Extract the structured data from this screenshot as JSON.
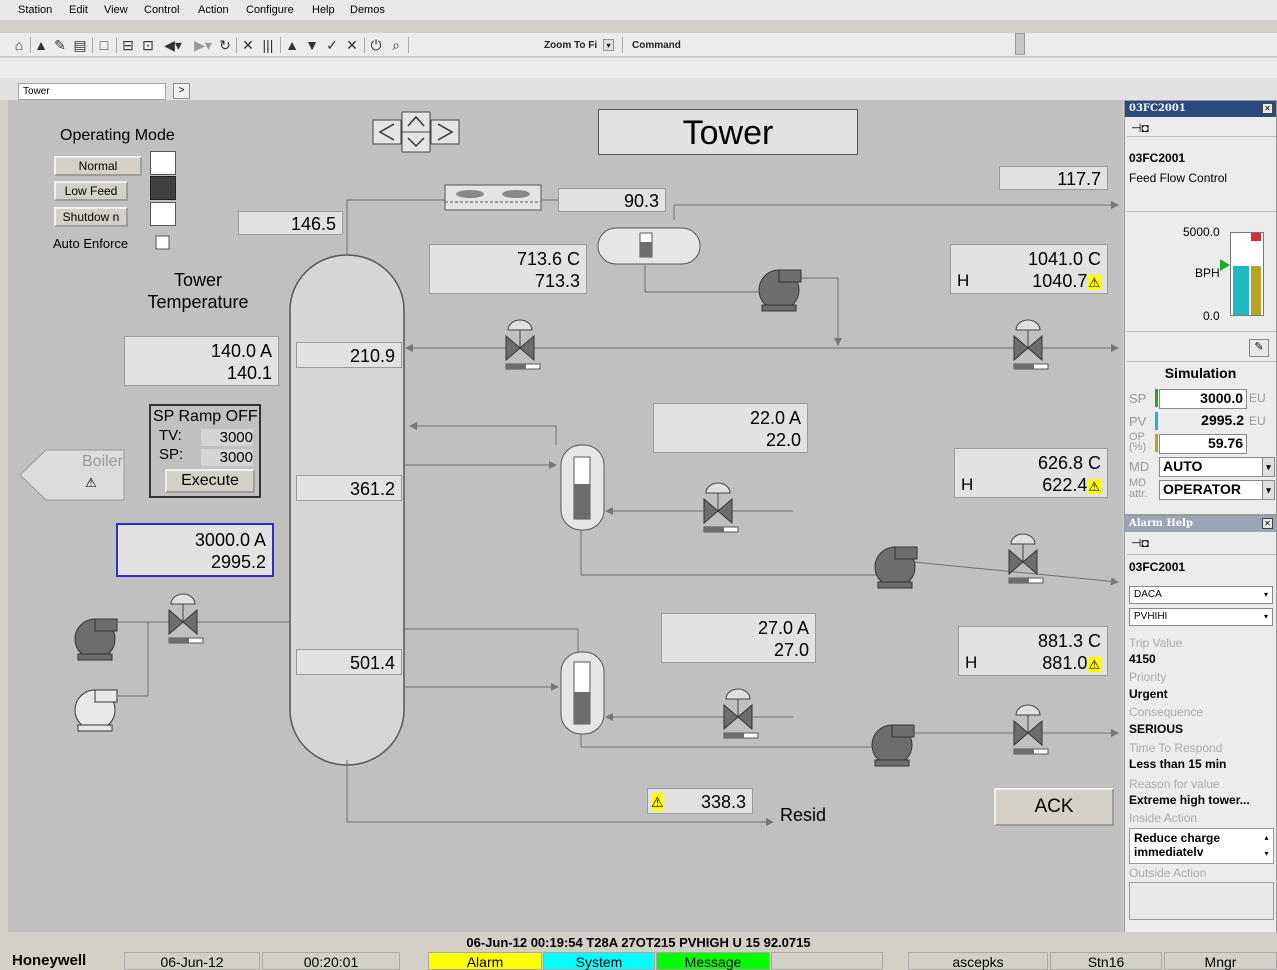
{
  "menu": [
    "Station",
    "Edit",
    "View",
    "Control",
    "Action",
    "Configure",
    "Help",
    "Demos"
  ],
  "toolbar": {
    "zoom": "Zoom To Fi",
    "command": "Command"
  },
  "tab": {
    "name": "Tower",
    "next": ">"
  },
  "display": {
    "title": "Tower",
    "operating_mode": {
      "label": "Operating Mode",
      "normal": "Normal",
      "low_feed": "Low  Feed",
      "shutdown": "Shutdow n",
      "auto_enforce": "Auto Enforce"
    },
    "tower_temp_label_1": "Tower",
    "tower_temp_label_2": "Temperature",
    "temp_sp": "140.0 A",
    "temp_pv": "140.1",
    "sp_ramp": {
      "title": "SP Ramp OFF",
      "tv_label": "TV:",
      "tv": "3000",
      "sp_label": "SP:",
      "sp": "3000",
      "execute": "Execute"
    },
    "boiler": "Boiler",
    "feed_sp": "3000.0 A",
    "feed_pv": "2995.2",
    "top_temp": "146.5",
    "tray1": "210.9",
    "tray2": "361.2",
    "tray3": "501.4",
    "overhead": "90.3",
    "off_gas": "117.7",
    "reflux_sp": "713.6 C",
    "reflux_pv": "713.3",
    "top_out_h": "H",
    "top_out_sp": "1041.0 C",
    "top_out_pv": "1040.7",
    "side1_sp": "22.0 A",
    "side1_pv": "22.0",
    "side1_out_h": "H",
    "side1_out_sp": "626.8 C",
    "side1_out_pv": "622.4",
    "side2_sp": "27.0 A",
    "side2_pv": "27.0",
    "side2_out_h": "H",
    "side2_out_sp": "881.3 C",
    "side2_out_pv": "881.0",
    "resid_val": "338.3",
    "resid_label": "Resid",
    "ack": "ACK"
  },
  "detail": {
    "title": "03FC2001",
    "tag": "03FC2001",
    "desc": "Feed Flow Control",
    "scale_hi": "5000.0",
    "unit": "BPH",
    "scale_lo": "0.0",
    "mode_label": "Simulation",
    "sp_label": "SP",
    "sp": "3000.0",
    "sp_eu": "EU",
    "pv_label": "PV",
    "pv": "2995.2",
    "pv_eu": "EU",
    "op_label": "OP",
    "op_pct": "(%)",
    "op": "59.76",
    "md_label": "MD",
    "md": "AUTO",
    "mda_label_1": "MD",
    "mda_label_2": "attr.",
    "mda": "OPERATOR",
    "sp_frac": 0.6,
    "pv_frac": 0.6,
    "op_frac": 0.6
  },
  "alarm_help": {
    "title": "Alarm Help",
    "tag": "03FC2001",
    "sel1": "DACA",
    "sel2": "PVHIHI",
    "trip_label": "Trip Value",
    "trip": "4150",
    "priority_label": "Priority",
    "priority": "Urgent",
    "consequence_label": "Consequence",
    "consequence": "SERIOUS",
    "time_label": "Time To Respond",
    "time": "Less than 15 min",
    "reason_label": "Reason for value",
    "reason": "Extreme high tower...",
    "inside_label": "Inside Action",
    "inside": "Reduce charge immediatelv",
    "outside_label": "Outside Action"
  },
  "status_line": "06-Jun-12  00:19:54  T28A  27OT215  PVHIGH   U 15 92.0715",
  "bottom": {
    "brand": "Honeywell",
    "date": "06-Jun-12",
    "time": "00:20:01",
    "alarm": "Alarm",
    "system": "System",
    "message": "Message",
    "user": "ascepks",
    "station": "Stn16",
    "level": "Mngr"
  },
  "colors": {
    "alarm": "#ffff00",
    "system": "#00ffff",
    "message": "#00ff00",
    "title_bar": "#2a4a7f"
  }
}
